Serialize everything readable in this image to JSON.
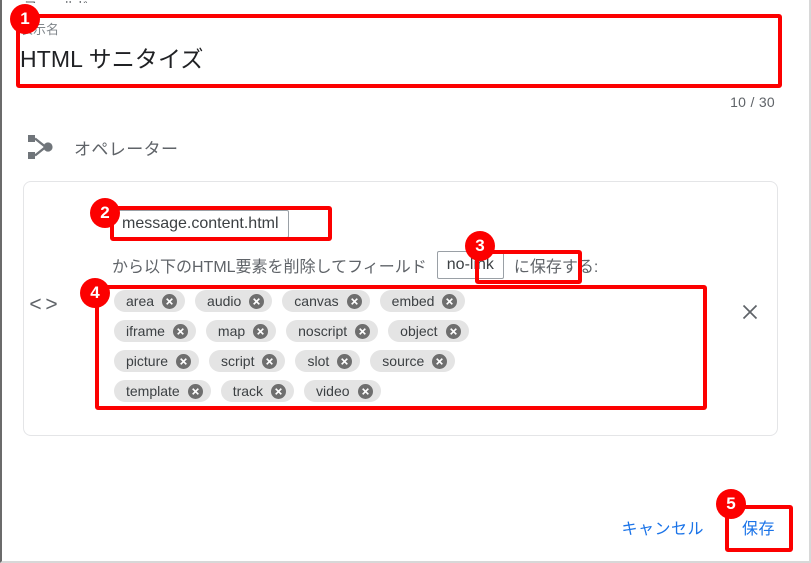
{
  "top_sliver_text": "フィールド",
  "name_field": {
    "label": "表示名",
    "value": "HTML サニタイズ",
    "counter": "10 / 30"
  },
  "operator": {
    "title": "オペレーター",
    "icon": "node-branch-icon"
  },
  "card": {
    "code_icon": "< >",
    "close_icon": "close-icon",
    "formula": {
      "source_token": "message.content.html",
      "middle_text": "から以下のHTML要素を削除してフィールド",
      "target_token": "no-link",
      "tail_text": "に保存する:"
    },
    "chip_rows": [
      [
        "area",
        "audio",
        "canvas",
        "embed"
      ],
      [
        "iframe",
        "map",
        "noscript",
        "object"
      ],
      [
        "picture",
        "script",
        "slot",
        "source"
      ],
      [
        "template",
        "track",
        "video"
      ]
    ]
  },
  "actions": {
    "cancel_label": "キャンセル",
    "save_label": "保存"
  },
  "annotations": {
    "badges": [
      "1",
      "2",
      "3",
      "4",
      "5"
    ]
  },
  "colors": {
    "accent_blue": "#1a73e8",
    "annotation_red": "#fc0000",
    "chip_bg": "#e4e4e4",
    "text_primary": "#202124",
    "text_secondary": "#5f6368"
  }
}
